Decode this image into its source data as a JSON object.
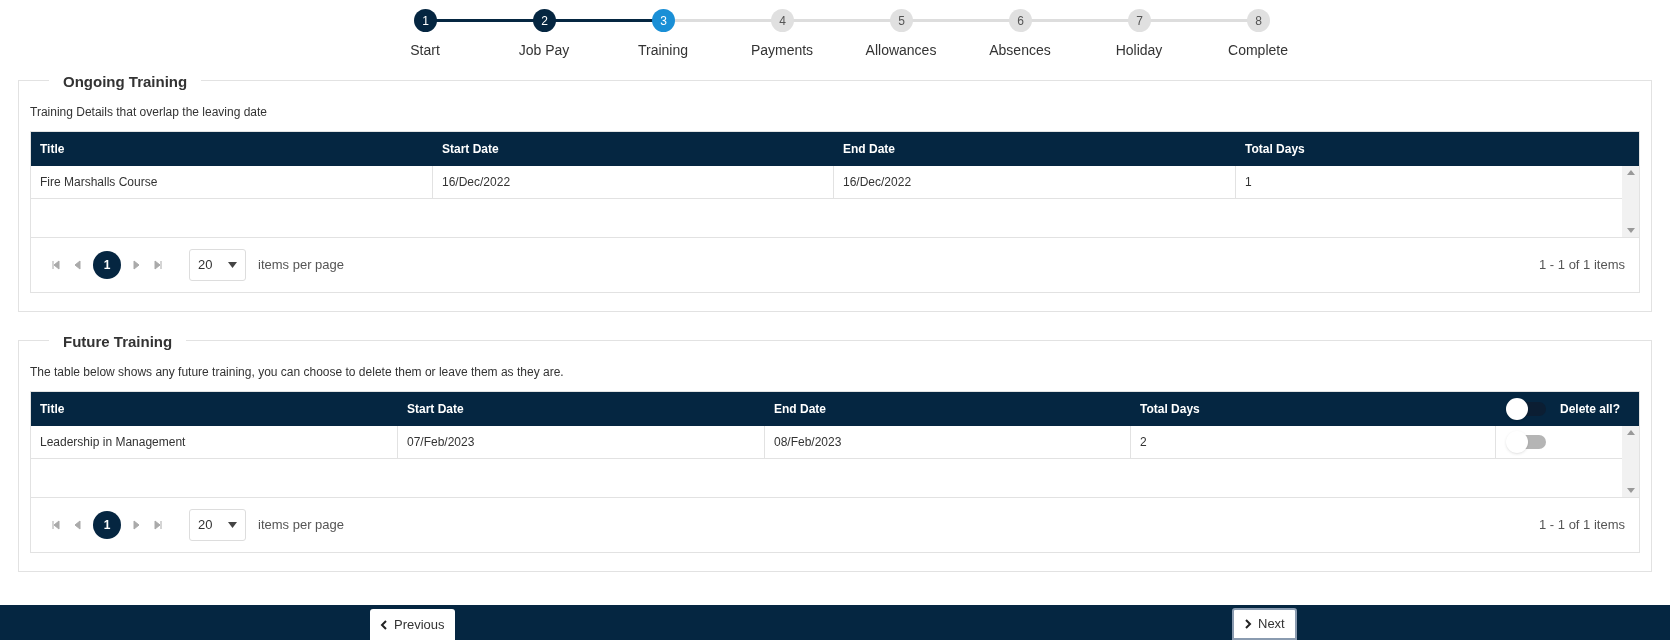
{
  "steps": [
    {
      "number": "1",
      "label": "Start",
      "completed": true,
      "selected": false
    },
    {
      "number": "2",
      "label": "Job Pay",
      "completed": true,
      "selected": false
    },
    {
      "number": "3",
      "label": "Training",
      "completed": false,
      "selected": true
    },
    {
      "number": "4",
      "label": "Payments",
      "completed": false,
      "selected": false
    },
    {
      "number": "5",
      "label": "Allowances",
      "completed": false,
      "selected": false
    },
    {
      "number": "6",
      "label": "Absences",
      "completed": false,
      "selected": false
    },
    {
      "number": "7",
      "label": "Holiday",
      "completed": false,
      "selected": false
    },
    {
      "number": "8",
      "label": "Complete",
      "completed": false,
      "selected": false
    }
  ],
  "sections": [
    {
      "legend": "Ongoing Training",
      "description": "Training Details that overlap the leaving date",
      "columns": [
        "Title",
        "Start Date",
        "End Date",
        "Total Days"
      ],
      "rows": [
        {
          "cells": [
            "Fire Marshalls Course",
            "16/Dec/2022",
            "16/Dec/2022",
            "1"
          ]
        }
      ],
      "pager": {
        "page": "1",
        "page_size": "20",
        "page_size_label": "items per page",
        "summary": "1 - 1 of 1 items"
      }
    },
    {
      "legend": "Future Training",
      "description": "The table below shows any future training, you can choose to delete them or leave them as they are.",
      "columns": [
        "Title",
        "Start Date",
        "End Date",
        "Total Days"
      ],
      "delete_all": {
        "label": "Delete all?",
        "on": false
      },
      "rows": [
        {
          "cells": [
            "Leadership in Management",
            "07/Feb/2023",
            "08/Feb/2023",
            "2"
          ],
          "delete": {
            "on": false
          }
        }
      ],
      "pager": {
        "page": "1",
        "page_size": "20",
        "page_size_label": "items per page",
        "summary": "1 - 1 of 1 items"
      }
    }
  ],
  "footer": {
    "previous": "Previous",
    "next": "Next"
  }
}
